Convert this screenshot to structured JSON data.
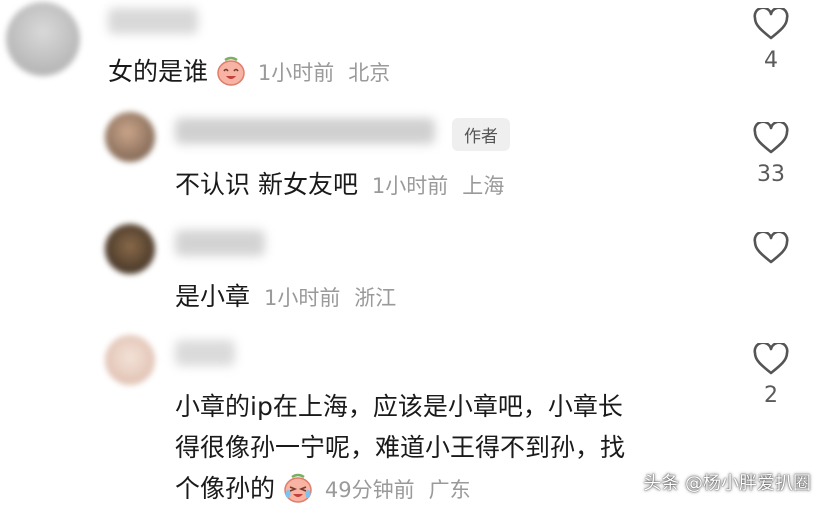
{
  "comments": [
    {
      "text": "女的是谁",
      "time": "1小时前",
      "location": "北京",
      "likes": "4",
      "emoji_icon": "laughing-face-emoji-icon"
    },
    {
      "badge": "作者",
      "text": "不认识 新女友吧",
      "time": "1小时前",
      "location": "上海",
      "likes": "33"
    },
    {
      "text": "是小章",
      "time": "1小时前",
      "location": "浙江",
      "likes": ""
    },
    {
      "text_lines": [
        "小章的ip在上海，应该是小章吧，小章长",
        "得很像孙一宁呢，难道小王得不到孙，找",
        "个像孙的"
      ],
      "time": "49分钟前",
      "location": "广东",
      "likes": "2",
      "emoji_icon": "crying-laughing-face-emoji-icon"
    }
  ],
  "watermark": "头条 @杨小胖爱扒圈",
  "colors": {
    "text": "#1a1a1a",
    "meta": "#9a9a9a",
    "icon": "#555555",
    "badge_bg": "#efefef",
    "emoji": "#f08a7a"
  }
}
